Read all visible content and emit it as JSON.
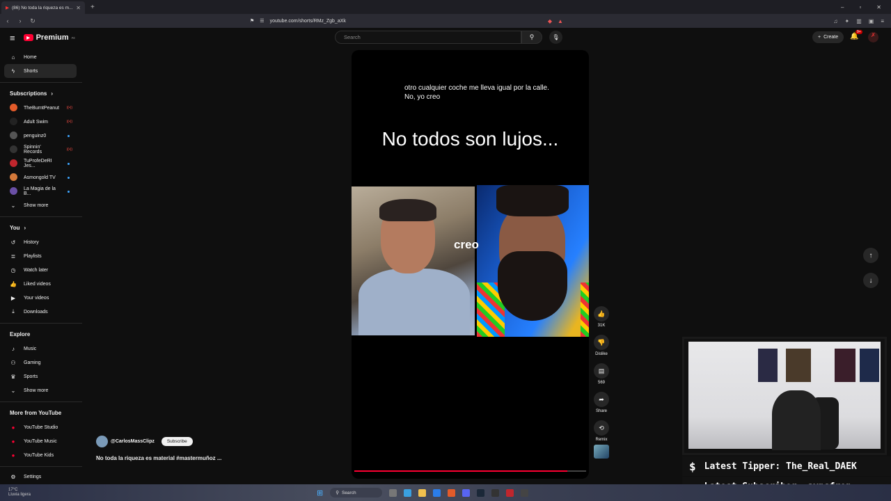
{
  "browser": {
    "tab_title": "(86) No toda la riqueza es m...",
    "url": "youtube.com/shorts/RMz_Zgb_aXk"
  },
  "masthead": {
    "logo_text": "Premium",
    "logo_sup": "PE",
    "search_placeholder": "Search",
    "create_label": "Create",
    "notif_badge": "9+"
  },
  "sidebar": {
    "main": [
      {
        "label": "Home",
        "icon": "home-icon"
      },
      {
        "label": "Shorts",
        "icon": "shorts-icon"
      }
    ],
    "subscriptions_header": "Subscriptions",
    "subscriptions": [
      {
        "label": "TheBurntPeanut",
        "color": "#e35b2a",
        "status": "live"
      },
      {
        "label": "Adult Swim",
        "color": "#222222",
        "status": "live"
      },
      {
        "label": "penguinz0",
        "color": "#555555",
        "status": "dot"
      },
      {
        "label": "Spinnin' Records",
        "color": "#333333",
        "status": "live"
      },
      {
        "label": "TuProfeDeRI Jes...",
        "color": "#c0262d",
        "status": "dot"
      },
      {
        "label": "Asmongold TV",
        "color": "#d4793a",
        "status": "dot"
      },
      {
        "label": "La Magia de la B...",
        "color": "#6a4fa5",
        "status": "dot"
      }
    ],
    "show_more": "Show more",
    "you_header": "You",
    "you": [
      {
        "label": "History",
        "icon": "history-icon"
      },
      {
        "label": "Playlists",
        "icon": "playlists-icon"
      },
      {
        "label": "Watch later",
        "icon": "clock-icon"
      },
      {
        "label": "Liked videos",
        "icon": "thumbs-up-icon"
      },
      {
        "label": "Your videos",
        "icon": "video-icon"
      },
      {
        "label": "Downloads",
        "icon": "download-icon"
      }
    ],
    "explore_header": "Explore",
    "explore": [
      {
        "label": "Music",
        "icon": "music-icon"
      },
      {
        "label": "Gaming",
        "icon": "gaming-icon"
      },
      {
        "label": "Sports",
        "icon": "trophy-icon"
      }
    ],
    "more_header": "More from YouTube",
    "more": [
      {
        "label": "YouTube Studio"
      },
      {
        "label": "YouTube Music"
      },
      {
        "label": "YouTube Kids"
      }
    ],
    "settings": "Settings"
  },
  "short": {
    "caption": "otro cualquier coche me lleva igual por la calle. No, yo creo",
    "big_title": "No todos son lujos...",
    "overlay_word": "creo",
    "progress": 0.92,
    "likes": "31K",
    "dislike_label": "Dislike",
    "comments": "569",
    "share_label": "Share",
    "remix_label": "Remix",
    "channel": "@CarlosMassClipz",
    "subscribe_label": "Subscribe",
    "title": "No toda la riqueza es material #mastermuñoz ..."
  },
  "stream_overlay": {
    "tipper": "Latest Tipper: The_Real_DAEK",
    "subscriber": "Latest Subscriber: aynsfron"
  },
  "taskbar": {
    "temp": "17°C",
    "weather": "Lluvia ligera",
    "search": "Search"
  }
}
